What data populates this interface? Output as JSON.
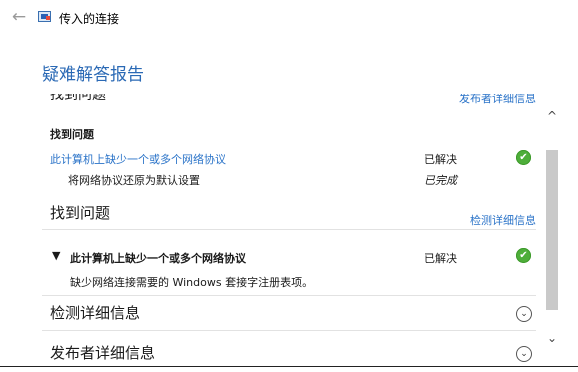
{
  "window": {
    "title": "传入的连接",
    "back_label": "←"
  },
  "page": {
    "heading": "疑难解答报告"
  },
  "clipped": {
    "top_left": "找到问题",
    "top_right_link": "发布者详细信息"
  },
  "section1": {
    "title": "找到问题",
    "problem_link": "此计算机上缺少一个或多个网络协议",
    "problem_status": "已解决",
    "sub_item": "将网络协议还原为默认设置",
    "sub_status": "已完成"
  },
  "section2": {
    "title": "找到问题",
    "details_link": "检测详细信息",
    "problem_title": "此计算机上缺少一个或多个网络协议",
    "problem_status": "已解决",
    "expand_glyph": "▼",
    "description": "缺少网络连接需要的 Windows 套接字注册表项。"
  },
  "section3": {
    "title": "检测详细信息"
  },
  "section4": {
    "title": "发布者详细信息"
  },
  "icons": {
    "check": "✔",
    "chevron_down": "⌄",
    "scroll_up": "^",
    "scroll_down": "⌄"
  },
  "colors": {
    "accent_blue": "#2a69b5",
    "link_blue": "#2a73c8",
    "success_green": "#4eae3a"
  }
}
